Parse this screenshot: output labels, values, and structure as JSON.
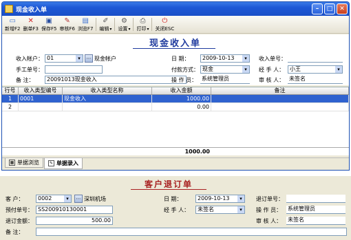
{
  "window": {
    "title": "现金收入单"
  },
  "toolbar": {
    "new": "新增F2",
    "delete": "删单F3",
    "save": "保存F5",
    "audit": "审核F6",
    "browse": "浏览F7",
    "edit": "编辑",
    "settings": "设置",
    "print": "打印",
    "close": "关闭ESC"
  },
  "receipt": {
    "heading": "现金收入单",
    "account_label": "收入帐户：",
    "account_value": "01",
    "account_name": "现金帐户",
    "manual_no_label": "手工单号：",
    "manual_no_value": "",
    "remark_label": "备    注：",
    "remark_value": "20091013现金收入",
    "date_label": "日    期：",
    "date_value": "2009-10-13",
    "pay_method_label": "付款方式：",
    "pay_method_value": "现金",
    "operator_label": "操 作 员：",
    "operator_value": "系统管理员",
    "doc_no_label": "收入单号：",
    "doc_no_value": "",
    "handler_label": "经 手 人：",
    "handler_value": "小王",
    "auditor_label": "审 核 人：",
    "auditor_value": "未签名"
  },
  "grid": {
    "columns": [
      "行号",
      "收入类型编号",
      "收入类型名称",
      "收入金额",
      "备注"
    ],
    "rows": [
      {
        "no": "1",
        "code": "0001",
        "name": "现金收入",
        "amount": "1000.00",
        "note": ""
      },
      {
        "no": "2",
        "code": "",
        "name": "",
        "amount": "0.00",
        "note": ""
      }
    ],
    "total": "1000.00"
  },
  "tabs": {
    "browse": "单据浏览",
    "entry": "单据录入"
  },
  "refund": {
    "heading": "客户退订单",
    "customer_label": "客    户：",
    "customer_value": "0002",
    "customer_name": "深圳机场",
    "prepay_no_label": "预付单号：",
    "prepay_no_value": "SS200910130001",
    "refund_amount_label": "退订金额：",
    "refund_amount_value": "500.00",
    "remark_label": "备    注：",
    "remark_value": "",
    "date_label": "日    期：",
    "date_value": "2009-10-13",
    "handler_label": "经 手 人：",
    "handler_value": "未签名",
    "doc_no_label": "退订单号：",
    "doc_no_value": "",
    "operator_label": "操 作 员：",
    "operator_value": "系统管理员",
    "auditor_label": "审 核 人：",
    "auditor_value": "未签名"
  }
}
